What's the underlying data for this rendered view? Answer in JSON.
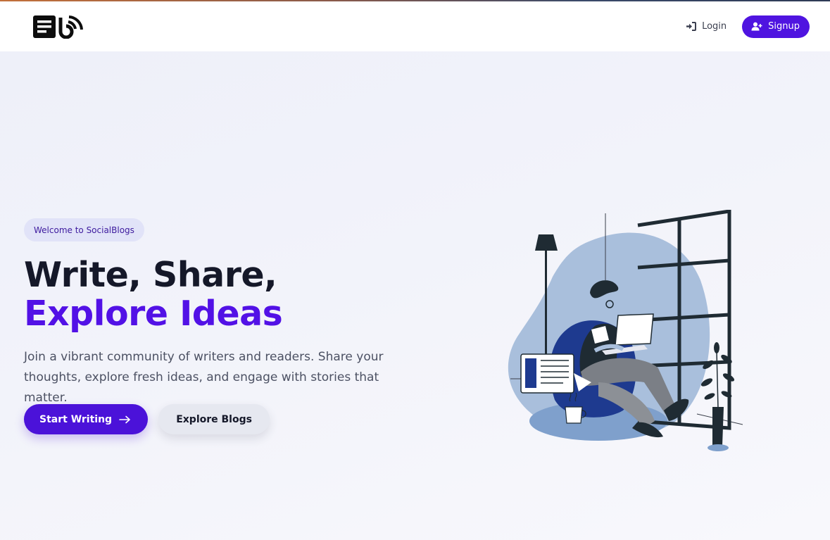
{
  "nav": {
    "logo_icon": "blog-rss-logo",
    "login_label": "Login",
    "login_icon": "sign-in-icon",
    "signup_label": "Signup",
    "signup_icon": "user-plus-icon"
  },
  "hero": {
    "badge": "Welcome to SocialBlogs",
    "headline_line1": "Write, Share,",
    "headline_line2": "Explore Ideas",
    "description": "Join a vibrant community of writers and readers. Share your thoughts, explore fresh ideas, and engage with stories that matter.",
    "primary_cta": "Start Writing",
    "primary_cta_icon": "arrow-right-icon",
    "secondary_cta": "Explore Blogs"
  },
  "colors": {
    "brand": "#4f14e0",
    "accent_text": "#5211e6",
    "heading": "#151829",
    "hero_bg": "#eef0f9"
  }
}
